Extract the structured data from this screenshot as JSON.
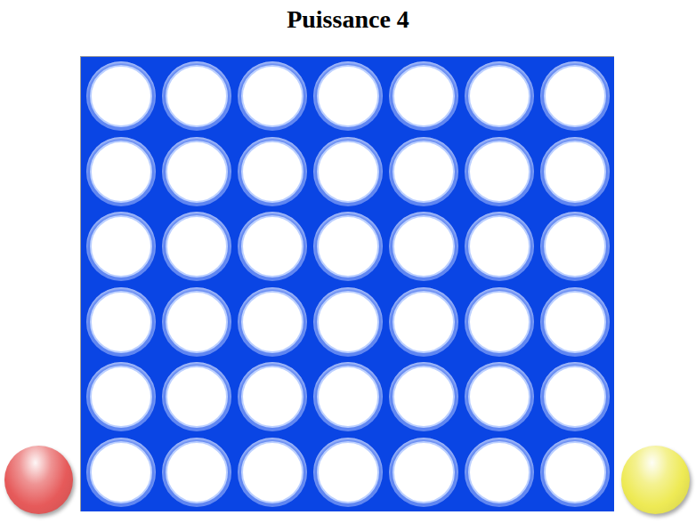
{
  "title": "Puissance 4",
  "board": {
    "rows": [
      [
        "empty",
        "empty",
        "empty",
        "empty",
        "empty",
        "empty",
        "empty"
      ],
      [
        "empty",
        "empty",
        "empty",
        "empty",
        "empty",
        "empty",
        "empty"
      ],
      [
        "empty",
        "empty",
        "empty",
        "empty",
        "empty",
        "empty",
        "empty"
      ],
      [
        "empty",
        "empty",
        "empty",
        "empty",
        "empty",
        "empty",
        "empty"
      ],
      [
        "empty",
        "empty",
        "empty",
        "empty",
        "empty",
        "empty",
        "empty"
      ],
      [
        "empty",
        "empty",
        "empty",
        "empty",
        "empty",
        "empty",
        "empty"
      ]
    ]
  },
  "players": [
    {
      "name": "red",
      "color": "#e65a5a"
    },
    {
      "name": "yellow",
      "color": "#eeea55"
    }
  ]
}
